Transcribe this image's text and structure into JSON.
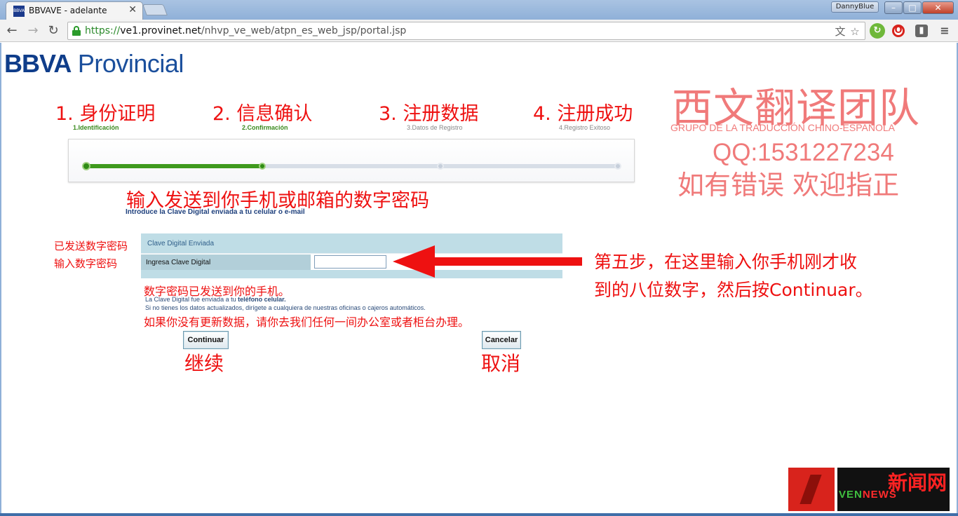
{
  "browser": {
    "tab_title": "BBVAVE - adelante",
    "tab_favicon_text": "BBVA",
    "user_name": "DannyBlue",
    "url_scheme": "https://",
    "url_host": "ve1.provinet.net",
    "url_path": "/nhvp_ve_web/atpn_es_web_jsp/portal.jsp",
    "icons": [
      "back-icon",
      "forward-icon",
      "reload-icon",
      "lock-icon",
      "translate-icon",
      "star-icon",
      "extension-icon",
      "opera-icon",
      "menu-icon"
    ]
  },
  "page": {
    "logo_bold": "BBVA",
    "logo_text": "Provincial",
    "steps": [
      {
        "cn": "1. 身份证明",
        "es": "1.Identificación",
        "state": "done"
      },
      {
        "cn": "2. 信息确认",
        "es": "2.Confirmación",
        "state": "current"
      },
      {
        "cn": "3. 注册数据",
        "es": "3.Datos de Registro",
        "state": "todo"
      },
      {
        "cn": "4. 注册成功",
        "es": "4.Registro Exitoso",
        "state": "todo"
      }
    ],
    "progress_fraction": 0.333,
    "intro_cn": "输入发送到你手机或邮箱的数字密码",
    "intro_es": "Introduce la Clave Digital enviada a tu celular o e-mail",
    "left_note_1": "已发送数字密码",
    "left_note_2": "输入数字密码",
    "panel_title": "Clave Digital Enviada",
    "field_label": "Ingresa Clave Digital",
    "field_value": "",
    "sent_note_cn": "数字密码已发送到你的手机。",
    "sent_note_es_pre": "La Clave Digital",
    "sent_note_es_mid": " fue enviada a tu ",
    "sent_note_es_end": "teléfono celular.",
    "update_note_es": "Si no tienes los datos actualizados, dirígete a cualquiera de nuestras oficinas o cajeros automáticos.",
    "update_note_cn": "如果你没有更新数据，请你去我们任何一间办公室或者柜台办理。",
    "continue_label": "Continuar",
    "continue_cn": "继续",
    "cancel_label": "Cancelar",
    "cancel_cn": "取消",
    "instruction_line_1": "第五步，在这里输入你手机刚才收",
    "instruction_line_2": "到的八位数字，然后按Continuar。"
  },
  "overlay": {
    "team_title": "西文翻译团队",
    "team_es": "GRUPO DE LA TRADUCCIÓN CHINO-ESPAÑOLA",
    "team_qq": "QQ:1531227234",
    "team_note": "如有错误  欢迎指正",
    "watermark_cn": "新闻网",
    "watermark_en_1": "VEN",
    "watermark_en_2": "NEWS"
  },
  "colors": {
    "brand_blue": "#1b4f9c",
    "annotation_red": "#ee1111",
    "team_pink": "#f07a7a",
    "progress_green": "#3f9a1e",
    "panel_blue": "#bfdde6"
  }
}
